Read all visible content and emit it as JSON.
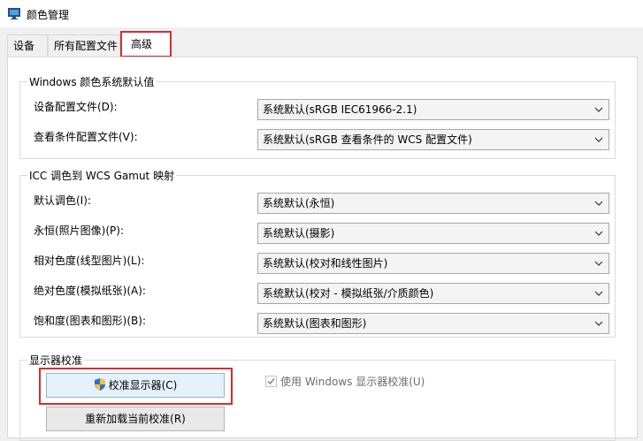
{
  "window": {
    "title": "颜色管理"
  },
  "tabs": [
    "设备",
    "所有配置文件",
    "高级"
  ],
  "windows_defaults": {
    "title": "Windows 颜色系统默认值",
    "rows": [
      {
        "label": "设备配置文件(D):",
        "value": "系统默认(sRGB IEC61966-2.1)"
      },
      {
        "label": "查看条件配置文件(V):",
        "value": "系统默认(sRGB 查看条件的 WCS 配置文件)"
      }
    ]
  },
  "icc_mapping": {
    "title": "ICC 调色到 WCS Gamut 映射",
    "rows": [
      {
        "label": "默认调色(I):",
        "value": "系统默认(永恒)"
      },
      {
        "label": "永恒(照片图像)(P):",
        "value": "系统默认(摄影)"
      },
      {
        "label": "相对色度(线型图片)(L):",
        "value": "系统默认(校对和线性图片)"
      },
      {
        "label": "绝对色度(模拟纸张)(A):",
        "value": "系统默认(校对 - 模拟纸张/介质颜色)"
      },
      {
        "label": "饱和度(图表和图形)(B):",
        "value": "系统默认(图表和图形)"
      }
    ]
  },
  "display_calibration": {
    "title": "显示器校准",
    "calibrate_button": "校准显示器(C)",
    "use_windows_calibration": {
      "label": "使用 Windows 显示器校准(U)",
      "checked": true,
      "enabled": false
    },
    "reload_button": "重新加载当前校准(R)"
  }
}
